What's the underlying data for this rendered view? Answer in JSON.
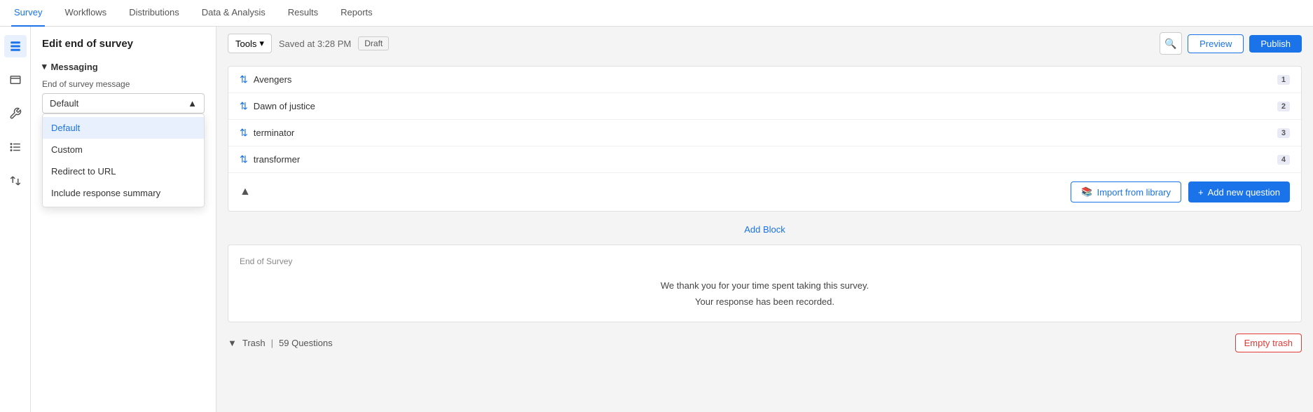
{
  "nav": {
    "items": [
      {
        "label": "Survey",
        "active": true
      },
      {
        "label": "Workflows",
        "active": false
      },
      {
        "label": "Distributions",
        "active": false
      },
      {
        "label": "Data & Analysis",
        "active": false
      },
      {
        "label": "Results",
        "active": false
      },
      {
        "label": "Reports",
        "active": false
      }
    ]
  },
  "left_panel": {
    "title": "Edit end of survey",
    "messaging_section": {
      "header": "Messaging",
      "field_label": "End of survey message",
      "dropdown": {
        "selected": "Default",
        "options": [
          {
            "label": "Default",
            "selected": true
          },
          {
            "label": "Custom",
            "selected": false
          },
          {
            "label": "Redirect to URL",
            "selected": false
          },
          {
            "label": "Include response summary",
            "selected": false
          }
        ]
      }
    }
  },
  "header": {
    "tools_label": "Tools",
    "saved_text": "Saved at 3:28 PM",
    "draft_label": "Draft",
    "preview_label": "Preview",
    "publish_label": "Publish"
  },
  "questions": [
    {
      "text": "Avengers",
      "num": "1"
    },
    {
      "text": "Dawn of justice",
      "num": "2"
    },
    {
      "text": "terminator",
      "num": "3"
    },
    {
      "text": "transformer",
      "num": "4"
    }
  ],
  "actions": {
    "import_label": "Import from library",
    "add_question_label": "Add new question"
  },
  "add_block_label": "Add Block",
  "end_of_survey": {
    "label": "End of Survey",
    "line1": "We thank you for your time spent taking this survey.",
    "line2": "Your response has been recorded."
  },
  "trash": {
    "label": "Trash",
    "count": "59 Questions",
    "empty_label": "Empty trash"
  },
  "icons": {
    "survey": "📋",
    "layers": "☰",
    "tools_icon": "🔧",
    "list": "📝",
    "arrows": "⇄",
    "search": "🔍",
    "sort": "⇅",
    "collapse": "▲",
    "chevron_down": "▾",
    "plus": "+",
    "import_lib": "📚",
    "trash_icon": "▼"
  }
}
